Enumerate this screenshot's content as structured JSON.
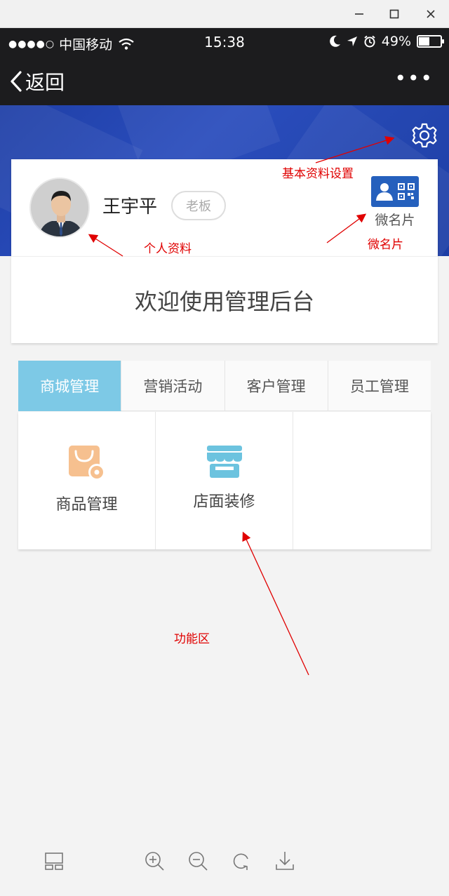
{
  "window": {
    "minimize_icon": "minimize-icon",
    "maximize_icon": "maximize-icon",
    "close_icon": "close-icon"
  },
  "status_bar": {
    "signal": "●●●●○",
    "carrier": "中国移动",
    "time": "15:38",
    "battery_text": "49%",
    "battery_level": 0.49
  },
  "nav": {
    "back_label": "返回",
    "more_label": "•••"
  },
  "profile": {
    "name": "王宇平",
    "role": "老板",
    "card_label": "微名片"
  },
  "welcome_text": "欢迎使用管理后台",
  "tabs": [
    {
      "label": "商城管理",
      "active": true
    },
    {
      "label": "营销活动",
      "active": false
    },
    {
      "label": "客户管理",
      "active": false
    },
    {
      "label": "员工管理",
      "active": false
    }
  ],
  "functions": [
    {
      "label": "商品管理",
      "icon": "shopping-bag-gear-icon"
    },
    {
      "label": "店面装修",
      "icon": "storefront-icon"
    }
  ],
  "annotations": {
    "settings": "基本资料设置",
    "profile": "个人资料",
    "card": "微名片",
    "functions": "功能区"
  },
  "colors": {
    "hero_blue": "#2446b0",
    "tab_active": "#7dc9e6",
    "card_button": "#2560bd",
    "annotation_red": "#e00000"
  }
}
